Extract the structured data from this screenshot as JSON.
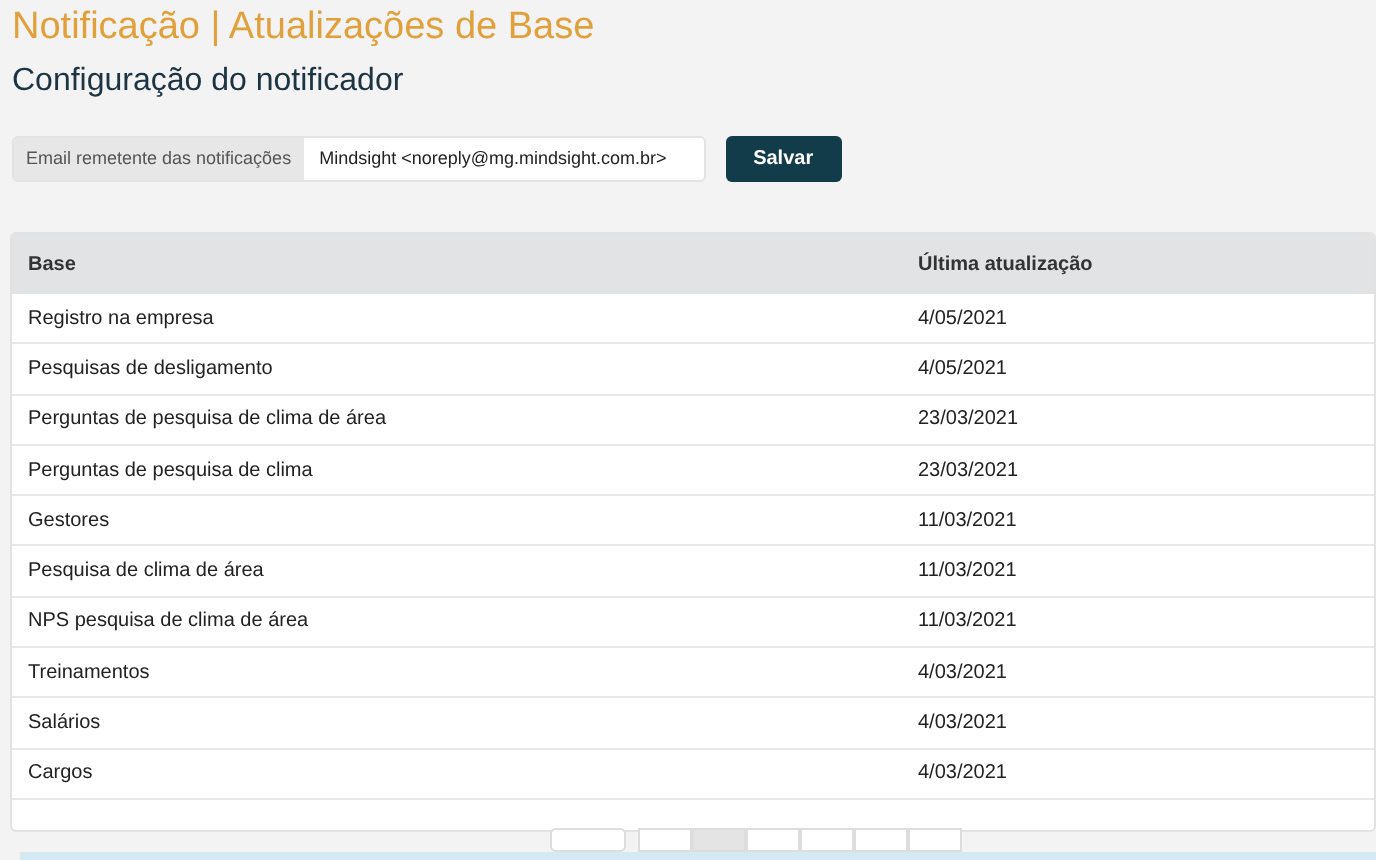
{
  "title": "Notificação | Atualizações de Base",
  "subtitle": "Configuração do notificador",
  "email": {
    "label": "Email remetente das notificações",
    "value": "Mindsight <noreply@mg.mindsight.com.br>",
    "button": "Salvar"
  },
  "table": {
    "columns": [
      "Base",
      "Última atualização"
    ],
    "rows": [
      [
        "Registro na empresa",
        "4/05/2021"
      ],
      [
        "Pesquisas de desligamento",
        "4/05/2021"
      ],
      [
        "Perguntas de pesquisa de clima de área",
        "23/03/2021"
      ],
      [
        "Perguntas de pesquisa de clima",
        "23/03/2021"
      ],
      [
        "Gestores",
        "11/03/2021"
      ],
      [
        "Pesquisa de clima de área",
        "11/03/2021"
      ],
      [
        "NPS pesquisa de clima de área",
        "11/03/2021"
      ],
      [
        "Treinamentos",
        "4/03/2021"
      ],
      [
        "Salários",
        "4/03/2021"
      ],
      [
        "Cargos",
        "4/03/2021"
      ]
    ]
  },
  "pagination": {
    "pages": [
      {
        "selected": false
      },
      {
        "selected": true
      },
      {
        "selected": false
      },
      {
        "selected": false
      },
      {
        "selected": false
      },
      {
        "selected": false
      }
    ]
  }
}
